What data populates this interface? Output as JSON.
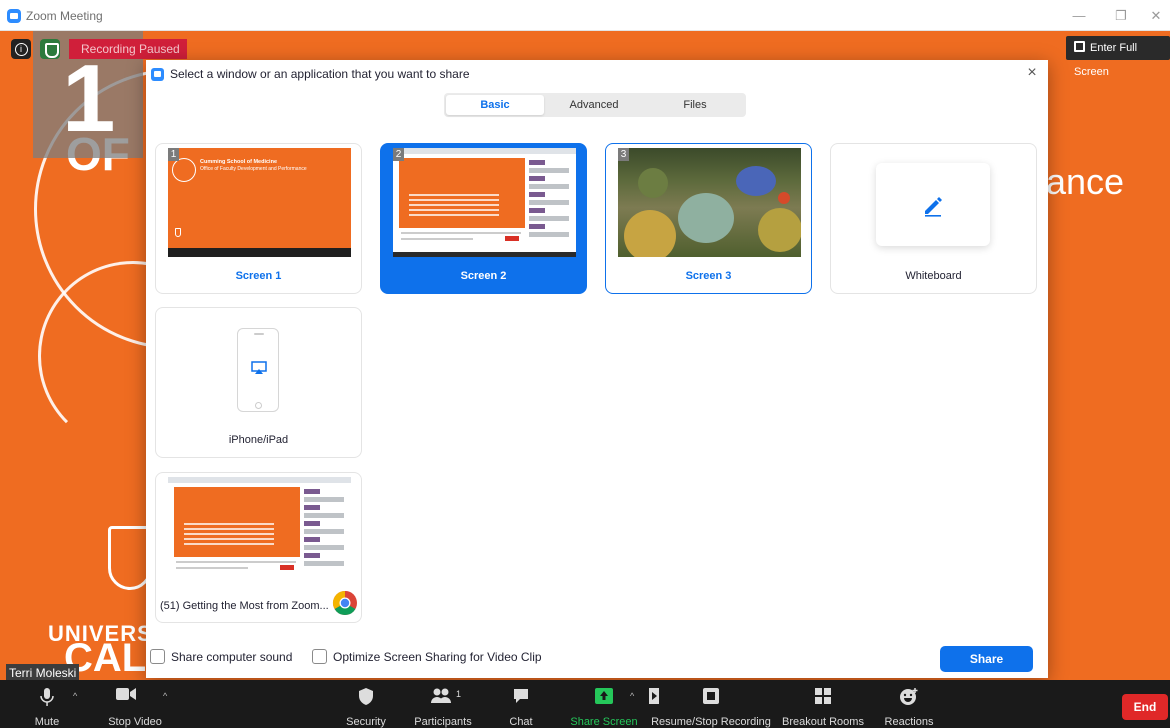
{
  "window": {
    "title": "Zoom Meeting"
  },
  "stage": {
    "slide_number": "1",
    "slide_text_of": "OF",
    "slide_text_right": "ance",
    "slide_text_univ": "UNIVERS",
    "slide_text_calg": "CALG",
    "recording_status": "Recording Paused",
    "fullscreen_label": "Enter Full Screen",
    "participant_name": "Terri Moleski",
    "info_glyph": "i"
  },
  "dialog": {
    "title": "Select a window or an application that you want to share",
    "close_glyph": "×",
    "tabs": [
      {
        "label": "Basic",
        "active": true
      },
      {
        "label": "Advanced",
        "active": false
      },
      {
        "label": "Files",
        "active": false
      }
    ],
    "cards": {
      "screen1": {
        "label": "Screen 1",
        "number": "1",
        "thumb_title": "Cumming School of Medicine",
        "thumb_subtitle": "Office of Faculty Development and Performance"
      },
      "screen2": {
        "label": "Screen 2",
        "number": "2"
      },
      "screen3": {
        "label": "Screen 3",
        "number": "3"
      },
      "whiteboard": {
        "label": "Whiteboard"
      },
      "iphone": {
        "label": "iPhone/iPad"
      },
      "chrome_window": {
        "label": "(51) Getting the Most from Zoom..."
      }
    },
    "options": {
      "share_sound": "Share computer sound",
      "optimize_video": "Optimize Screen Sharing for Video Clip"
    },
    "share_button": "Share"
  },
  "toolbar": {
    "items": [
      {
        "label": "Mute",
        "icon": "microphone-icon"
      },
      {
        "label": "Stop Video",
        "icon": "video-camera-icon"
      },
      {
        "label": "Security",
        "icon": "shield-icon"
      },
      {
        "label": "Participants",
        "icon": "participants-icon",
        "count": "1"
      },
      {
        "label": "Chat",
        "icon": "chat-icon"
      },
      {
        "label": "Share Screen",
        "icon": "share-screen-icon"
      },
      {
        "label": "Resume/Stop Recording",
        "icon": "recording-icon"
      },
      {
        "label": "Breakout Rooms",
        "icon": "breakout-rooms-icon"
      },
      {
        "label": "Reactions",
        "icon": "reactions-icon"
      }
    ],
    "end_label": "End",
    "share_color": "#25c75a"
  },
  "colors": {
    "accent": "#0e71eb",
    "stage": "#ef6c21",
    "end": "#e02828"
  }
}
